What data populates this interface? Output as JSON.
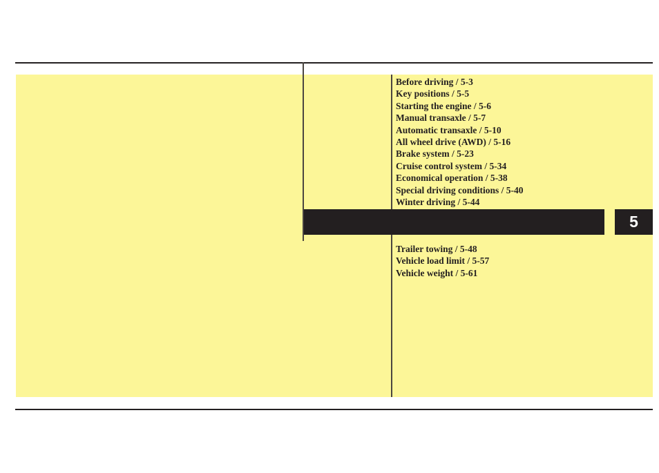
{
  "page": {
    "background_color": "#ffffff",
    "panel_color": "#fcf698",
    "ink_color": "#231f20",
    "chapter_number": "5"
  },
  "contents": {
    "upper_items": [
      "Before driving / 5-3",
      "Key positions / 5-5",
      "Starting the engine / 5-6",
      "Manual transaxle / 5-7",
      "Automatic transaxle / 5-10",
      "All wheel drive (AWD) / 5-16",
      "Brake system / 5-23",
      "Cruise control system / 5-34",
      "Economical operation / 5-38",
      "Special driving conditions / 5-40",
      "Winter driving / 5-44"
    ],
    "lower_items": [
      "Trailer towing / 5-48",
      "Vehicle load limit / 5-57",
      "Vehicle weight / 5-61"
    ]
  }
}
